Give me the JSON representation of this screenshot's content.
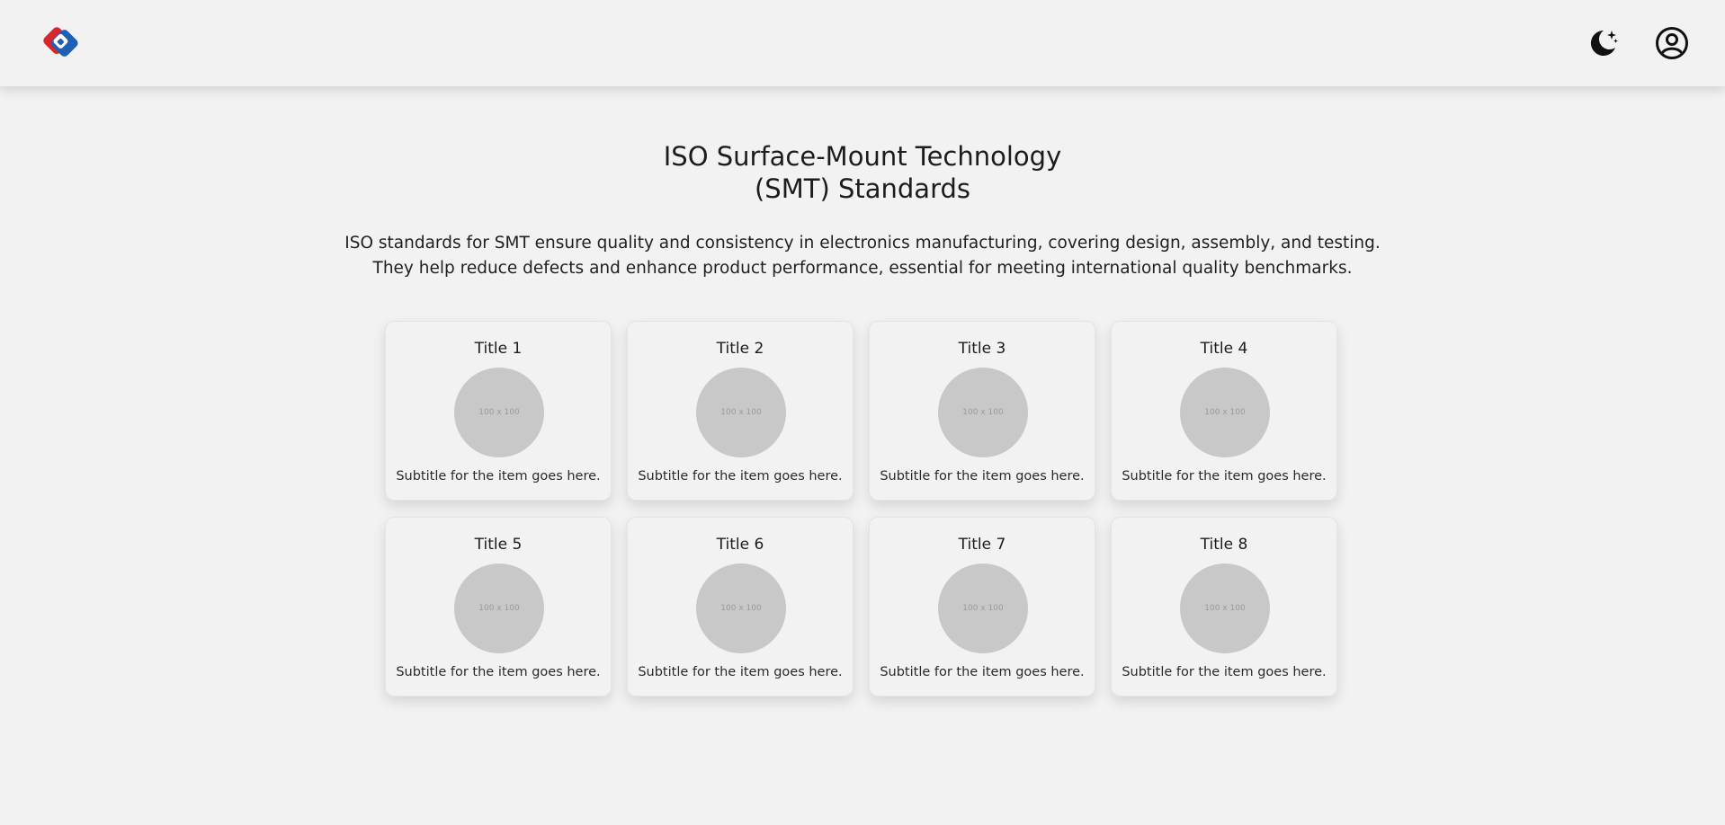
{
  "header": {
    "logo_icon": "brand-diamond-logo",
    "theme_toggle_icon": "moon-stars-icon",
    "account_icon": "user-circle-icon",
    "colors": {
      "logo_blue": "#1f5fb4",
      "logo_red": "#d9262c",
      "icon": "#111111"
    }
  },
  "main": {
    "title_line1": "ISO Surface-Mount Technology",
    "title_line2": "(SMT) Standards",
    "description_line1": "ISO standards for SMT ensure quality and consistency in electronics manufacturing, covering design, assembly, and testing.",
    "description_line2": "They help reduce defects and enhance product performance, essential for meeting international quality benchmarks."
  },
  "cards": [
    {
      "title": "Title 1",
      "image_label": "100 x 100",
      "subtitle": "Subtitle for the item goes here."
    },
    {
      "title": "Title 2",
      "image_label": "100 x 100",
      "subtitle": "Subtitle for the item goes here."
    },
    {
      "title": "Title 3",
      "image_label": "100 x 100",
      "subtitle": "Subtitle for the item goes here."
    },
    {
      "title": "Title 4",
      "image_label": "100 x 100",
      "subtitle": "Subtitle for the item goes here."
    },
    {
      "title": "Title 5",
      "image_label": "100 x 100",
      "subtitle": "Subtitle for the item goes here."
    },
    {
      "title": "Title 6",
      "image_label": "100 x 100",
      "subtitle": "Subtitle for the item goes here."
    },
    {
      "title": "Title 7",
      "image_label": "100 x 100",
      "subtitle": "Subtitle for the item goes here."
    },
    {
      "title": "Title 8",
      "image_label": "100 x 100",
      "subtitle": "Subtitle for the item goes here."
    }
  ]
}
